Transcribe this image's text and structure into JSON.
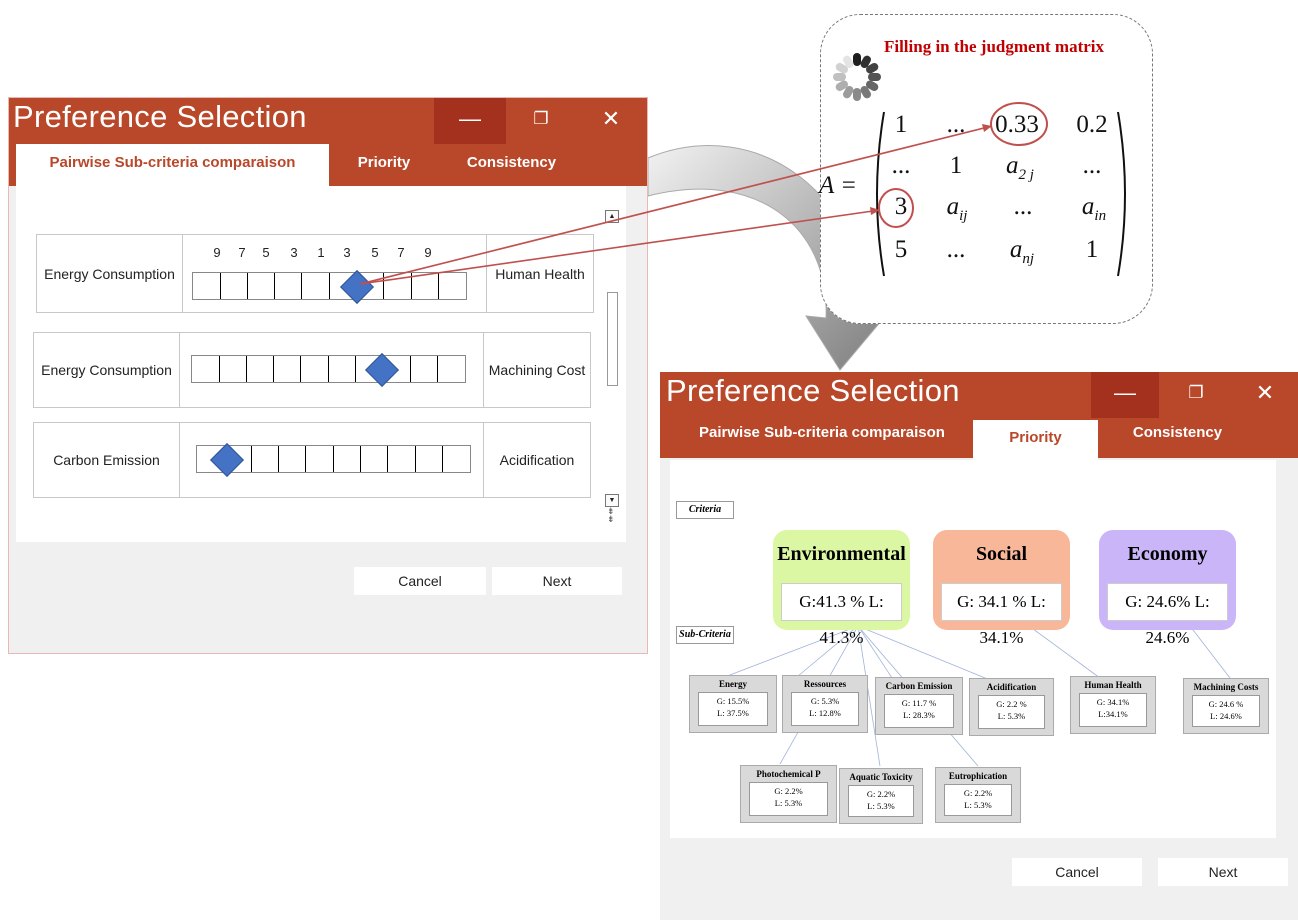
{
  "window1": {
    "title": "Preference Selection",
    "min_icon": "minimize-icon",
    "restore_icon": "restore-icon",
    "close_icon": "close-icon",
    "tabs": [
      {
        "label": "Pairwise Sub-criteria comparaison",
        "active": true
      },
      {
        "label": "Priority",
        "active": false
      },
      {
        "label": "Consistency",
        "active": false
      }
    ],
    "scale_labels": [
      "9",
      "7",
      "5",
      "3",
      "1",
      "3",
      "5",
      "7",
      "9"
    ],
    "rows": [
      {
        "left": "Energy Consumption",
        "right": "Human Health",
        "selected": "3",
        "selected_side": "right"
      },
      {
        "left": "Energy Consumption",
        "right": "Machining Cost",
        "selected": "5",
        "selected_side": "right"
      },
      {
        "left": "Carbon Emission",
        "right": "Acidification",
        "selected": "7",
        "selected_side": "left"
      }
    ],
    "cancel_label": "Cancel",
    "next_label": "Next"
  },
  "matrix_panel": {
    "title": "Filling in the judgment matrix",
    "lhs": "A =",
    "rows": [
      [
        "1",
        "...",
        "0.33",
        "0.2"
      ],
      [
        "...",
        "1",
        "a2j",
        "..."
      ],
      [
        "3",
        "aij",
        "...",
        "ain"
      ],
      [
        "5",
        "...",
        "anj",
        "1"
      ]
    ],
    "highlight_color": "#c0504d"
  },
  "window2": {
    "title": "Preference Selection",
    "tabs": [
      {
        "label": "Pairwise Sub-criteria comparaison",
        "active": false
      },
      {
        "label": "Priority",
        "active": true
      },
      {
        "label": "Consistency",
        "active": false
      }
    ],
    "criteria_tag": "Criteria",
    "subcriteria_tag": "Sub-Criteria",
    "criteria": [
      {
        "name": "Environmental",
        "value": "G:41.3 % L: 41.3%",
        "color": "#dcf7a3"
      },
      {
        "name": "Social",
        "value": "G: 34.1 % L: 34.1%",
        "color": "#f9b79a"
      },
      {
        "name": "Economy",
        "value": "G: 24.6% L: 24.6%",
        "color": "#c9b5f7"
      }
    ],
    "subcriteria": [
      {
        "name": "Energy",
        "g": "G: 15.5%",
        "l": "L: 37.5%"
      },
      {
        "name": "Ressources",
        "g": "G: 5.3%",
        "l": "L: 12.8%"
      },
      {
        "name": "Carbon Emission",
        "g": "G: 11.7 %",
        "l": "L: 28.3%"
      },
      {
        "name": "Acidification",
        "g": "G: 2.2 %",
        "l": "L: 5.3%"
      },
      {
        "name": "Human Health",
        "g": "G: 34.1%",
        "l": "L:34.1%"
      },
      {
        "name": "Machining Costs",
        "g": "G: 24.6 %",
        "l": "L: 24.6%"
      },
      {
        "name": "Photochemical P",
        "g": "G: 2.2%",
        "l": "L: 5.3%"
      },
      {
        "name": "Aquatic Toxicity",
        "g": "G: 2.2%",
        "l": "L: 5.3%"
      },
      {
        "name": "Eutrophication",
        "g": "G: 2.2%",
        "l": "L: 5.3%"
      }
    ],
    "cancel_label": "Cancel",
    "next_label": "Next"
  },
  "colors": {
    "title_bar": "#b9472a",
    "accent": "#b9472a",
    "diamond": "#4472c4"
  }
}
